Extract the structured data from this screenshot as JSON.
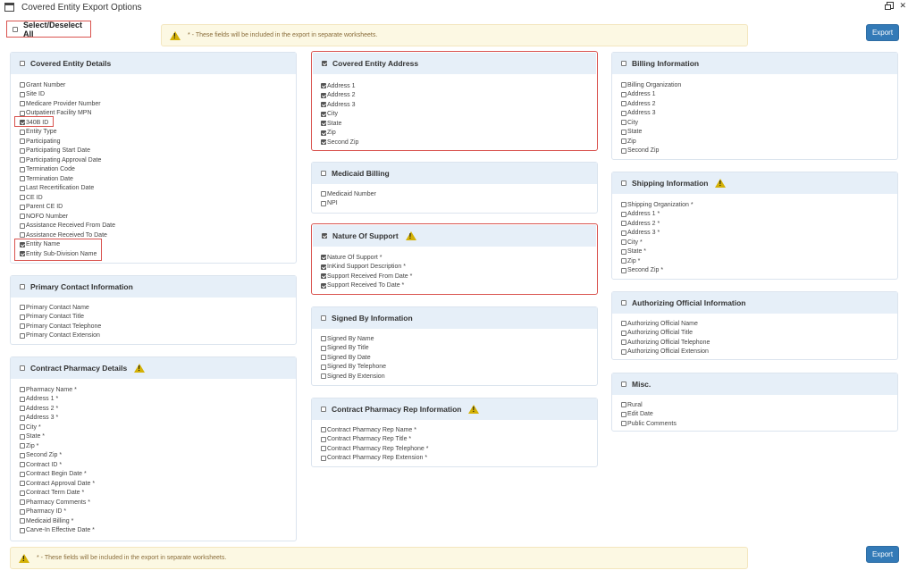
{
  "window": {
    "title": "Covered Entity Export Options"
  },
  "select_all": {
    "label": "Select/Deselect All",
    "checked": false
  },
  "notice_text": "* - These fields will be included in the export in separate worksheets.",
  "export_label": "Export",
  "panels": {
    "covered_entity_details": {
      "title": "Covered Entity Details",
      "items": [
        "Grant Number",
        "Site ID",
        "Medicare Provider Number",
        "Outpatient Facility MPN",
        "340B ID",
        "Entity Type",
        "Participating",
        "Participating Start Date",
        "Participating Approval Date",
        "Termination Code",
        "Termination Date",
        "Last Recertification Date",
        "CE ID",
        "Parent CE ID",
        "NOFO Number",
        "Assistance Received From Date",
        "Assistance Received To Date",
        "Entity Name",
        "Entity Sub-Division Name"
      ],
      "checked": [
        "340B ID",
        "Entity Name",
        "Entity Sub-Division Name"
      ]
    },
    "primary_contact": {
      "title": "Primary Contact Information",
      "items": [
        "Primary Contact Name",
        "Primary Contact Title",
        "Primary Contact Telephone",
        "Primary Contact Extension"
      ]
    },
    "contract_pharmacy": {
      "title": "Contract Pharmacy Details",
      "items": [
        "Pharmacy Name *",
        "Address 1 *",
        "Address 2 *",
        "Address 3 *",
        "City *",
        "State *",
        "Zip *",
        "Second Zip *",
        "Contract ID *",
        "Contract Begin Date *",
        "Contract Approval Date *",
        "Contract Term Date *",
        "Pharmacy Comments *",
        "Pharmacy ID *",
        "Medicaid Billing *",
        "Carve-In Effective Date *"
      ]
    },
    "covered_entity_address": {
      "title": "Covered Entity Address",
      "items": [
        "Address 1",
        "Address 2",
        "Address 3",
        "City",
        "State",
        "Zip",
        "Second Zip"
      ]
    },
    "medicaid_billing": {
      "title": "Medicaid Billing",
      "items": [
        "Medicaid Number",
        "NPI"
      ]
    },
    "nature_of_support": {
      "title": "Nature Of Support",
      "items": [
        "Nature Of Support *",
        "InKind Support Description *",
        "Support Received From Date *",
        "Support Received To Date *"
      ]
    },
    "signed_by": {
      "title": "Signed By Information",
      "items": [
        "Signed By Name",
        "Signed By Title",
        "Signed By Date",
        "Signed By Telephone",
        "Signed By Extension"
      ]
    },
    "contract_pharmacy_rep": {
      "title": "Contract Pharmacy Rep Information",
      "items": [
        "Contract Pharmacy Rep Name *",
        "Contract Pharmacy Rep Title *",
        "Contract Pharmacy Rep Telephone *",
        "Contract Pharmacy Rep Extension *"
      ]
    },
    "billing_information": {
      "title": "Billing Information",
      "items": [
        "Billing Organization",
        "Address 1",
        "Address 2",
        "Address 3",
        "City",
        "State",
        "Zip",
        "Second Zip"
      ]
    },
    "shipping_information": {
      "title": "Shipping Information",
      "items": [
        "Shipping Organization *",
        "Address 1 *",
        "Address 2 *",
        "Address 3 *",
        "City *",
        "State *",
        "Zip *",
        "Second Zip *"
      ]
    },
    "authorizing_official": {
      "title": "Authorizing Official Information",
      "items": [
        "Authorizing Official Name",
        "Authorizing Official Title",
        "Authorizing Official Telephone",
        "Authorizing Official Extension"
      ]
    },
    "misc": {
      "title": "Misc.",
      "items": [
        "Rural",
        "Edit Date",
        "Public Comments"
      ]
    }
  }
}
